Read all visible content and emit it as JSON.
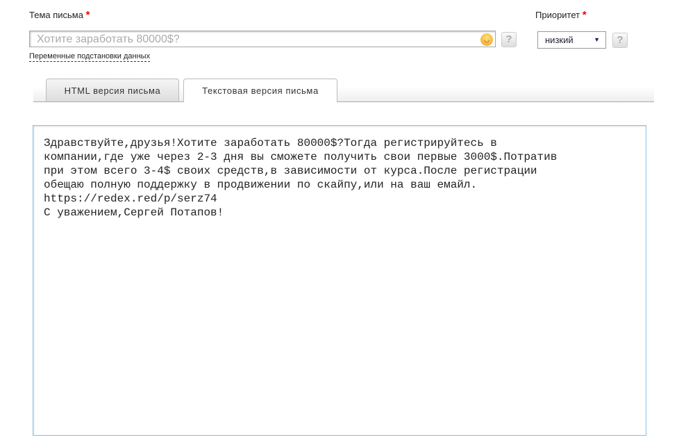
{
  "subject": {
    "label": "Тема письма",
    "required": "*",
    "value": "Хотите заработать 80000$?",
    "help": "?",
    "vars_link": "Переменные подстановки данных"
  },
  "priority": {
    "label": "Приоритет",
    "required": "*",
    "selected": "низкий",
    "help": "?"
  },
  "tabs": [
    {
      "label": "HTML версия письма",
      "active": false
    },
    {
      "label": "Текстовая версия письма",
      "active": true
    }
  ],
  "body_text": "Здравствуйте,друзья!Хотите заработать 80000$?Тогда регистрируйтесь в\nкомпании,где уже через 2-3 дня вы сможете получить свои первые 3000$.Потратив\nпри этом всего 3-4$ своих средств,в зависимости от курса.После регистрации\nобещаю полную поддержку в продвижении по скайпу,или на ваш емайл.\nhttps://redex.red/p/serz74\nС уважением,Сергей Потапов!"
}
